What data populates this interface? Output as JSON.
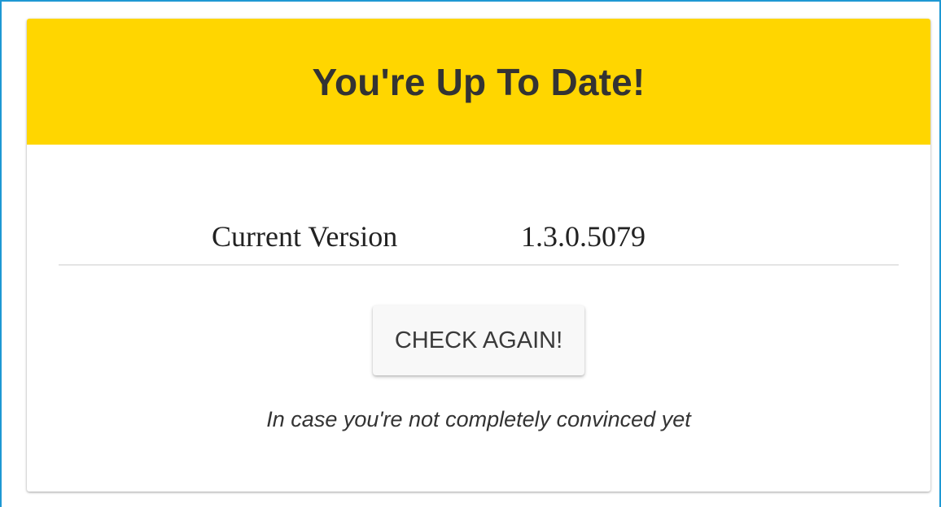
{
  "update_card": {
    "title": "You're Up To Date!",
    "header_color": "#ffd600",
    "current_version_label": "Current Version",
    "current_version_value": "1.3.0.5079",
    "check_again_label": "CHECK AGAIN!",
    "note": "In case you're not completely convinced yet"
  }
}
